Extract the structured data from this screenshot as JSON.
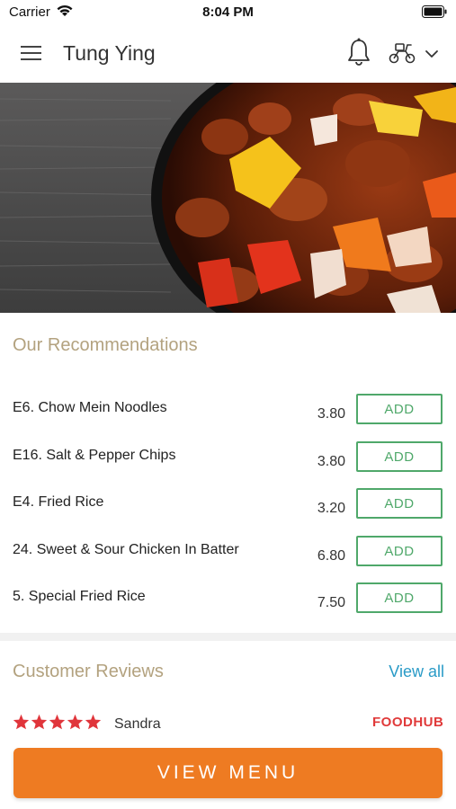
{
  "status_bar": {
    "carrier": "Carrier",
    "time": "8:04 PM"
  },
  "header": {
    "title": "Tung Ying",
    "icons": [
      "menu-icon",
      "bell-icon",
      "scooter-icon",
      "chevron-down-icon"
    ]
  },
  "hero": {
    "image": "sweet-sour-chicken-photo"
  },
  "recommendations": {
    "title": "Our Recommendations",
    "items": [
      {
        "name": "E6. Chow Mein Noodles",
        "price": "3.80",
        "button": "ADD"
      },
      {
        "name": "E16. Salt & Pepper Chips",
        "price": "3.80",
        "button": "ADD"
      },
      {
        "name": "E4. Fried Rice",
        "price": "3.20",
        "button": "ADD"
      },
      {
        "name": "24. Sweet & Sour Chicken In Batter",
        "price": "6.80",
        "button": "ADD"
      },
      {
        "name": "5. Special Fried Rice",
        "price": "7.50",
        "button": "ADD"
      }
    ]
  },
  "reviews": {
    "title": "Customer Reviews",
    "view_all": "View all",
    "items": [
      {
        "reviewer": "Sandra",
        "rating": 5,
        "source": "FOODHUB"
      }
    ]
  },
  "cta": {
    "label": "VIEW MENU"
  },
  "colors": {
    "accent_gold": "#b3a27f",
    "add_green": "#4fa86a",
    "link_blue": "#2a9bc7",
    "cta_orange": "#ee7b22",
    "star_red": "#e0353b"
  }
}
